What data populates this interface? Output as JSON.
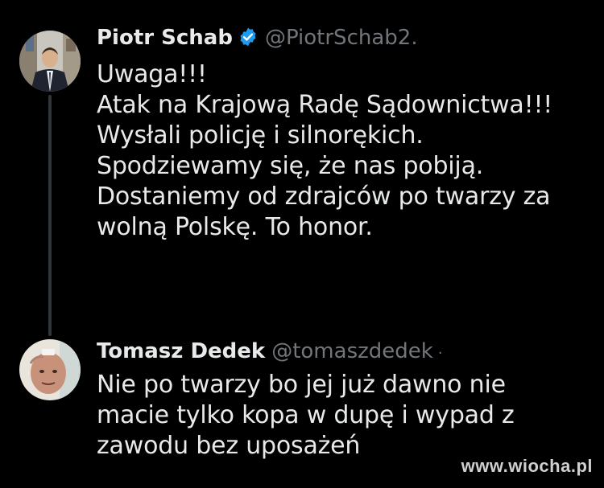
{
  "thread": {
    "tweets": [
      {
        "display_name": "Piotr Schab",
        "verified": true,
        "handle": "@PiotrSchab2.",
        "body_lines": [
          "Uwaga!!!",
          "Atak na Krajową Radę Sądownictwa!!!",
          "Wysłali policję i silnorękich.",
          "Spodziewamy się, że nas pobiją.",
          "Dostaniemy od zdrajców po twarzy za",
          "wolną Polskę. To honor."
        ]
      },
      {
        "display_name": "Tomasz Dedek",
        "verified": false,
        "handle": "@tomaszdedek",
        "separator": "·",
        "body_lines": [
          "Nie po twarzy bo jej już dawno nie",
          "macie tylko kopa w dupę i wypad z",
          "zawodu bez uposażeń"
        ]
      }
    ]
  },
  "watermark": "www.wiocha.pl",
  "colors": {
    "background": "#000000",
    "text_primary": "#e7e9ea",
    "text_secondary": "#71767b",
    "verified_badge": "#1d9bf0",
    "thread_line": "#333639"
  }
}
